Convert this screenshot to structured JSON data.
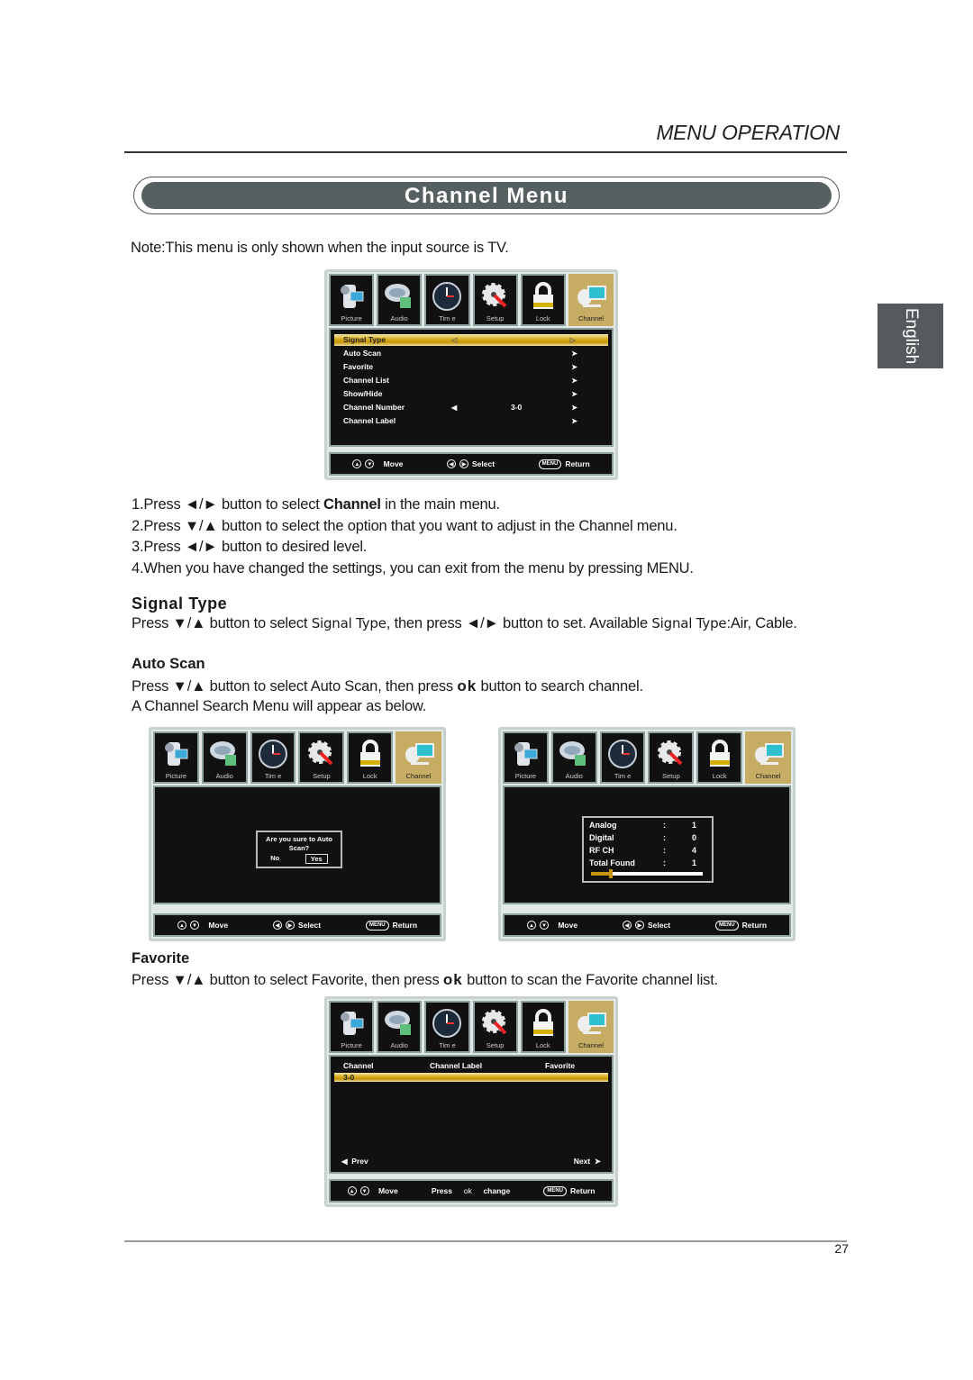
{
  "header": {
    "section": "MENU OPERATION",
    "title": "Channel Menu",
    "language_tab": "English"
  },
  "note": "Note:This menu is only shown when the input source is TV.",
  "menu_tabs": [
    "Picture",
    "Audio",
    "Tim e",
    "Setup",
    "Lock",
    "Channel"
  ],
  "active_tab": "Channel",
  "footer_hints": {
    "move": "Move",
    "select": "Select",
    "menu_key": "MENU",
    "return": "Return",
    "press": "Press",
    "ok": "ok",
    "change": "change"
  },
  "channel_menu": {
    "items": [
      {
        "label": "Signal Type",
        "value": "",
        "highlighted": true
      },
      {
        "label": "Auto Scan",
        "value": ""
      },
      {
        "label": "Favorite",
        "value": ""
      },
      {
        "label": "Channel List",
        "value": ""
      },
      {
        "label": "Show/Hide",
        "value": ""
      },
      {
        "label": "Channel Number",
        "value": "3-0"
      },
      {
        "label": "Channel Label",
        "value": ""
      }
    ]
  },
  "steps": {
    "s1_pre": "1.Press ◄/► button to select ",
    "s1_bold": "Channel",
    "s1_post": " in the main menu.",
    "s2": "2.Press ▼/▲ button to select the option that you want to adjust in the Channel menu.",
    "s3": "3.Press ◄/► button to desired level.",
    "s4": "4.When you have changed the settings, you can exit from the menu by pressing MENU."
  },
  "signal_type": {
    "heading": "Signal Type",
    "p1": "Press ▼/▲ button to select ",
    "term": "Signal Type",
    "p2": ", then press ◄/► button to set. Available ",
    "term2": "Signal Type",
    "p3": ":Air, Cable."
  },
  "auto_scan": {
    "heading": "Auto Scan",
    "p1": "Press ▼/▲ button to select Auto Scan, then press ",
    "ok": "ok",
    "p2": " button to search channel.",
    "line2": "A Channel Search Menu will appear as below.",
    "confirm_dialog": {
      "question": "Are you sure to Auto Scan?",
      "no": "No",
      "yes": "Yes",
      "selected": "Yes"
    },
    "scan_results": {
      "rows": [
        {
          "label": "Analog",
          "sep": ":",
          "value": "1"
        },
        {
          "label": "Digital",
          "sep": ":",
          "value": "0"
        },
        {
          "label": "RF CH",
          "sep": ":",
          "value": "4"
        },
        {
          "label": "Total Found",
          "sep": ":",
          "value": "1"
        }
      ],
      "progress_fraction": 0.18
    }
  },
  "favorite": {
    "heading": "Favorite",
    "p1": "Press ▼/▲ button to select Favorite, then press ",
    "ok": "ok",
    "p2": " button to scan the Favorite channel list.",
    "table": {
      "columns": [
        "Channel",
        "Channel Label",
        "Favorite"
      ],
      "rows": [
        {
          "channel": "3-0",
          "label": "",
          "favorite": ""
        }
      ],
      "prev": "Prev",
      "next": "Next"
    }
  },
  "page_number": "27",
  "colors": {
    "title_bar": "#566061",
    "highlight": "#d7aa1a",
    "active_tab": "#c6ad63",
    "language_tab": "#555b5c"
  }
}
